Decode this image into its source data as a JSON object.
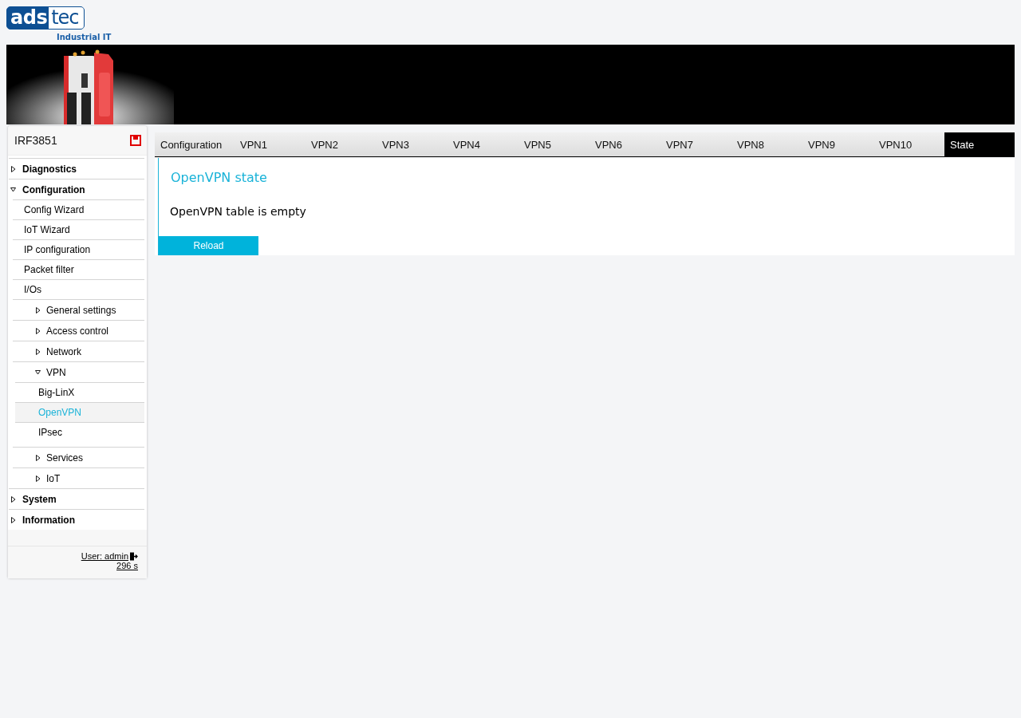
{
  "logo": {
    "boxed": "ads",
    "plain": "tec",
    "tagline": "Industrial IT"
  },
  "sidebar": {
    "device": "IRF3851",
    "items": [
      {
        "label": "Diagnostics",
        "expanded": false
      },
      {
        "label": "Configuration",
        "expanded": true,
        "children": [
          {
            "label": "Config Wizard",
            "selected": false
          },
          {
            "label": "IoT Wizard",
            "selected": false
          },
          {
            "label": "IP configuration",
            "selected": false
          },
          {
            "label": "Packet filter",
            "selected": false
          },
          {
            "label": "I/Os",
            "selected": false,
            "children": [
              {
                "label": "General settings",
                "expanded": false
              },
              {
                "label": "Access control",
                "expanded": false
              },
              {
                "label": "Network",
                "expanded": false
              },
              {
                "label": "VPN",
                "expanded": true,
                "children": [
                  {
                    "label": "Big-LinX",
                    "selected": false
                  },
                  {
                    "label": "OpenVPN",
                    "selected": true
                  },
                  {
                    "label": "IPsec",
                    "selected": false
                  }
                ]
              },
              {
                "label": "Services",
                "expanded": false
              },
              {
                "label": "IoT",
                "expanded": false
              }
            ]
          }
        ]
      },
      {
        "label": "System",
        "expanded": false
      },
      {
        "label": "Information",
        "expanded": false
      }
    ],
    "user": "User: admin",
    "timer": "296 s"
  },
  "tabs": [
    {
      "label": "Configuration",
      "selected": false
    },
    {
      "label": "VPN1",
      "selected": false
    },
    {
      "label": "VPN2",
      "selected": false
    },
    {
      "label": "VPN3",
      "selected": false
    },
    {
      "label": "VPN4",
      "selected": false
    },
    {
      "label": "VPN5",
      "selected": false
    },
    {
      "label": "VPN6",
      "selected": false
    },
    {
      "label": "VPN7",
      "selected": false
    },
    {
      "label": "VPN8",
      "selected": false
    },
    {
      "label": "VPN9",
      "selected": false
    },
    {
      "label": "VPN10",
      "selected": false
    },
    {
      "label": "State",
      "selected": true
    }
  ],
  "panel": {
    "title": "OpenVPN state",
    "message": "OpenVPN table is empty",
    "button": "Reload"
  }
}
